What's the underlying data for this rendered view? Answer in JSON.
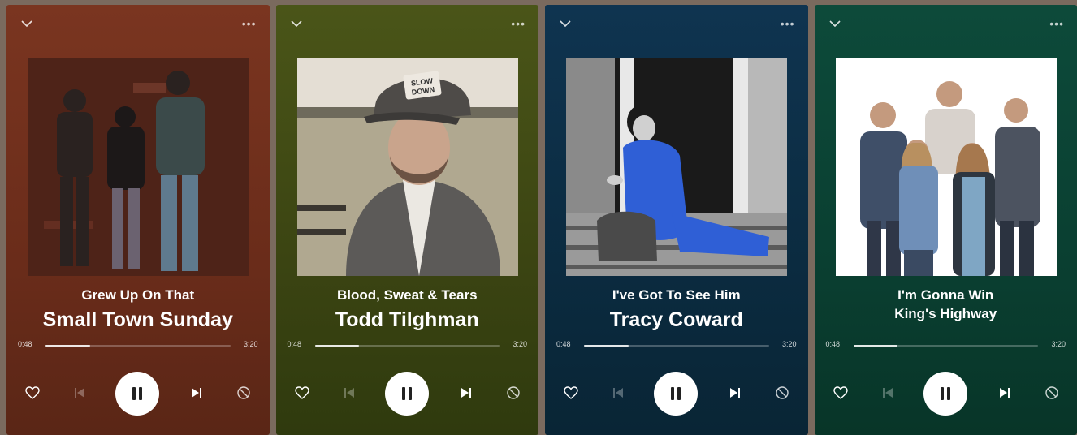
{
  "ui": {
    "pause_glyph": "pause",
    "icons": [
      "chevron-down-icon",
      "more-icon",
      "heart-icon",
      "previous-icon",
      "pause-icon",
      "next-icon",
      "block-icon"
    ]
  },
  "cards": [
    {
      "song": "Grew Up On That",
      "artist": "Small Town Sunday",
      "elapsed": "0:48",
      "total": "3:20",
      "progress": 0.24,
      "bg": "#6a2c1a",
      "art_alt": "photo of three band members standing against a brick wall"
    },
    {
      "song": "Blood, Sweat & Tears",
      "artist": "Todd Tilghman",
      "elapsed": "0:48",
      "total": "3:20",
      "progress": 0.24,
      "bg": "#3b4412",
      "art_alt": "photo of a smiling man in a baseball cap and jacket"
    },
    {
      "song": "I've Got To See Him",
      "artist": "Tracy Coward",
      "elapsed": "0:48",
      "total": "3:20",
      "progress": 0.24,
      "bg": "#0b2b40",
      "art_alt": "photo of a woman in a blue top sitting on porch steps"
    },
    {
      "song": "I'm Gonna Win",
      "artist": "King's Highway",
      "elapsed": "0:48",
      "total": "3:20",
      "progress": 0.24,
      "bg": "#0a3f31",
      "art_alt": "photo of a five-member group on a white background"
    }
  ]
}
